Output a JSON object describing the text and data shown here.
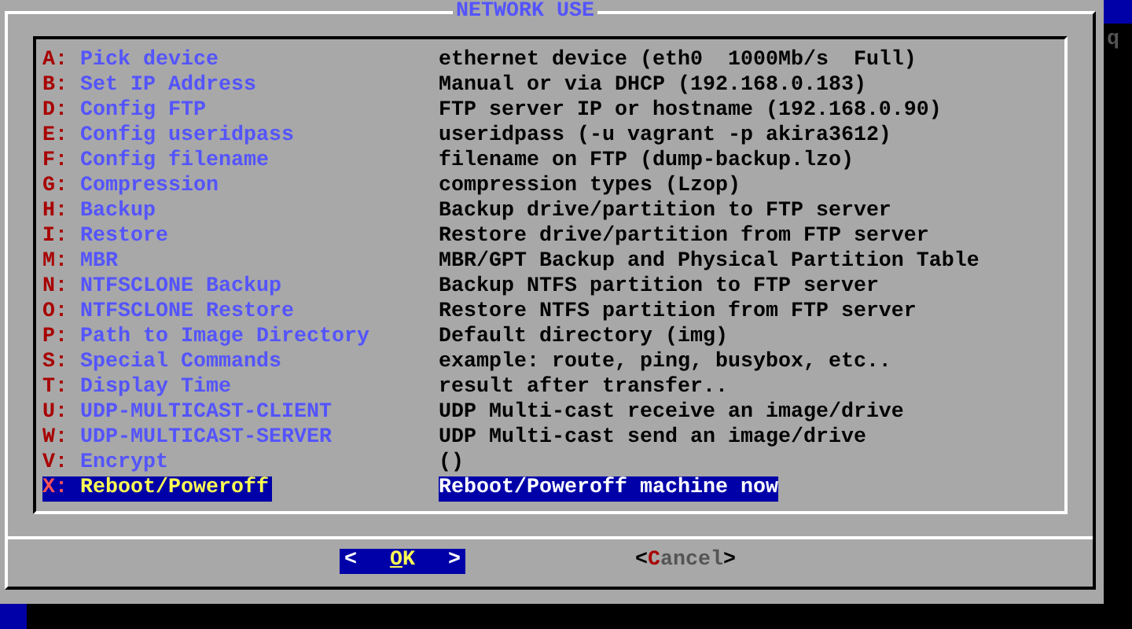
{
  "dialog": {
    "title": "NETWORK USE"
  },
  "menu": [
    {
      "key": "A:",
      "label": "Pick device",
      "description": "ethernet device (eth0  1000Mb/s  Full)",
      "selected": false
    },
    {
      "key": "B:",
      "label": "Set IP Address",
      "description": "Manual or via DHCP (192.168.0.183)",
      "selected": false
    },
    {
      "key": "D:",
      "label": "Config FTP",
      "description": "FTP server IP or hostname (192.168.0.90)",
      "selected": false
    },
    {
      "key": "E:",
      "label": "Config useridpass",
      "description": "useridpass (-u vagrant -p akira3612)",
      "selected": false
    },
    {
      "key": "F:",
      "label": "Config filename",
      "description": "filename on FTP (dump-backup.lzo)",
      "selected": false
    },
    {
      "key": "G:",
      "label": "Compression",
      "description": "compression types (Lzop)",
      "selected": false
    },
    {
      "key": "H:",
      "label": "Backup",
      "description": "Backup drive/partition to FTP server",
      "selected": false
    },
    {
      "key": "I:",
      "label": "Restore",
      "description": "Restore drive/partition from FTP server",
      "selected": false
    },
    {
      "key": "M:",
      "label": "MBR",
      "description": "MBR/GPT Backup and Physical Partition Table",
      "selected": false
    },
    {
      "key": "N:",
      "label": "NTFSCLONE Backup",
      "description": "Backup NTFS partition to FTP server",
      "selected": false
    },
    {
      "key": "O:",
      "label": "NTFSCLONE Restore",
      "description": "Restore NTFS partition from FTP server",
      "selected": false
    },
    {
      "key": "P:",
      "label": "Path to Image Directory",
      "description": "Default directory (img)",
      "selected": false
    },
    {
      "key": "S:",
      "label": "Special Commands",
      "description": "example: route, ping, busybox, etc..",
      "selected": false
    },
    {
      "key": "T:",
      "label": "Display Time",
      "description": "result after transfer..",
      "selected": false
    },
    {
      "key": "U:",
      "label": "UDP-MULTICAST-CLIENT",
      "description": "UDP Multi-cast receive an image/drive",
      "selected": false
    },
    {
      "key": "W:",
      "label": "UDP-MULTICAST-SERVER",
      "description": "UDP Multi-cast send an image/drive",
      "selected": false
    },
    {
      "key": "V:",
      "label": "Encrypt",
      "description": "()",
      "selected": false
    },
    {
      "key": "X:",
      "label": "Reboot/Poweroff",
      "description": "Reboot/Poweroff machine now",
      "selected": true
    }
  ],
  "buttons": [
    {
      "open": "<",
      "label": "OK",
      "close": ">",
      "selected": true
    },
    {
      "open": "<",
      "label": "Cancel",
      "close": ">",
      "selected": false
    }
  ],
  "background_text": "q"
}
